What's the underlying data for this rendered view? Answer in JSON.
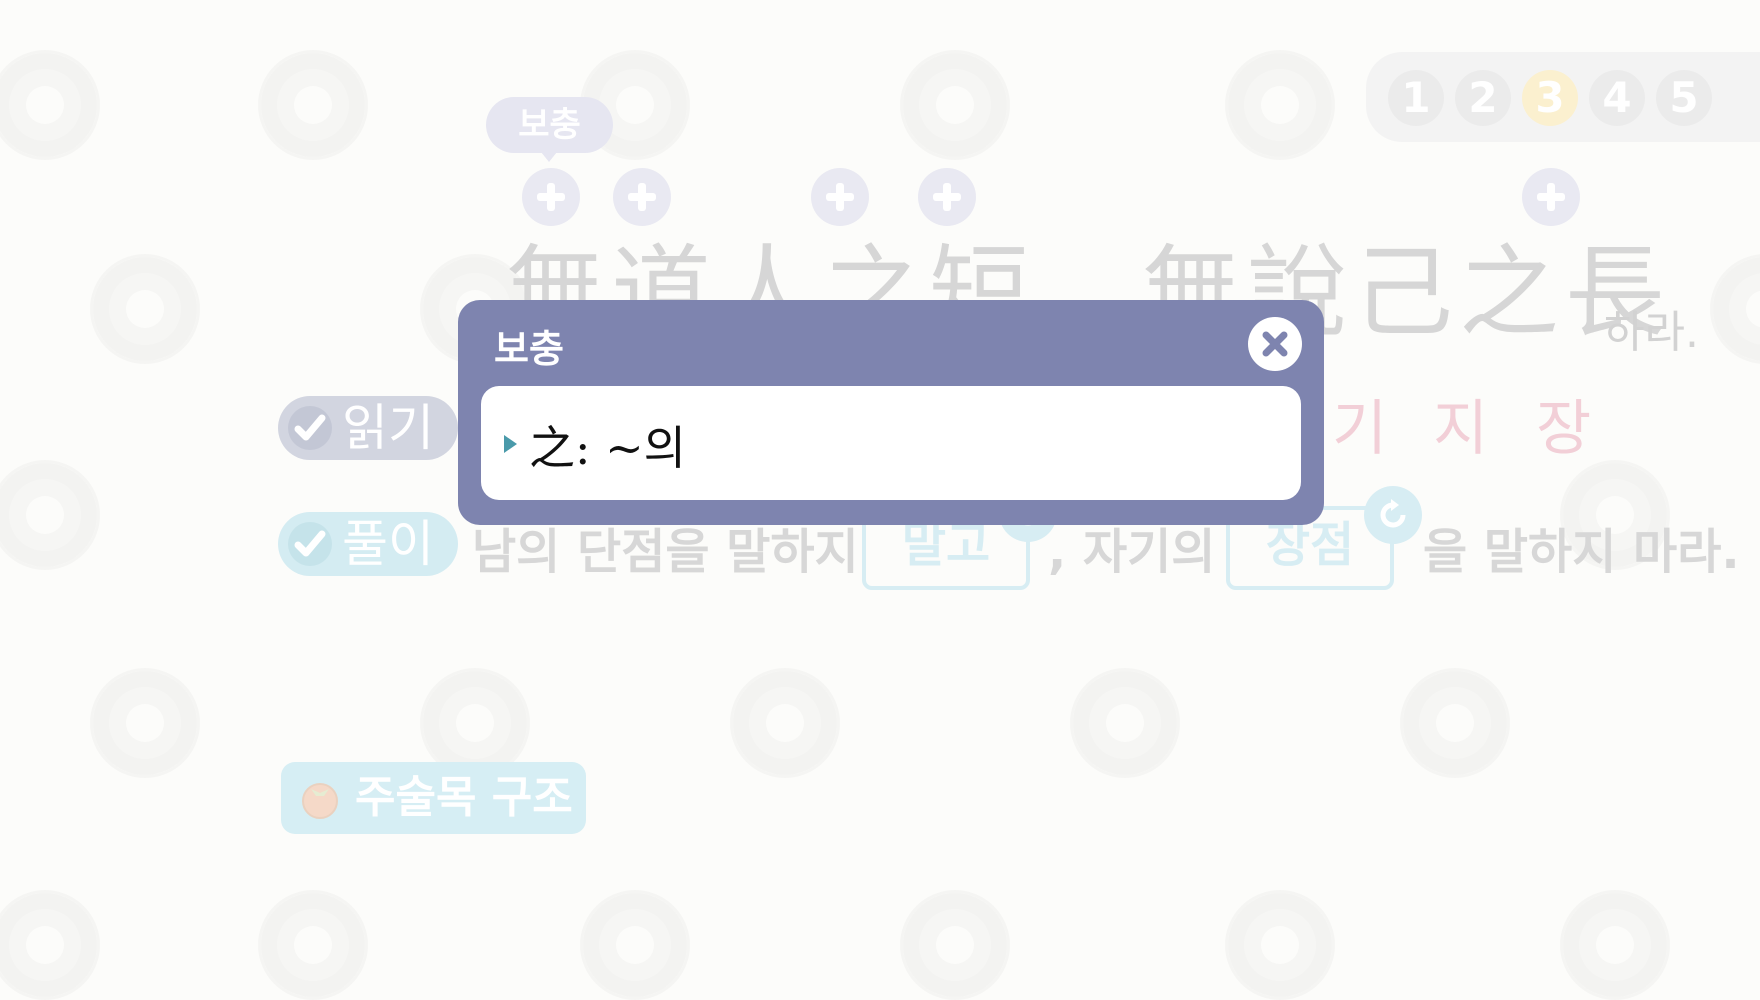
{
  "pagination": {
    "pages": [
      "1",
      "2",
      "3",
      "4",
      "5"
    ],
    "active": "3"
  },
  "tooltip": {
    "label": "보충"
  },
  "hanja_line": {
    "text": "無道人之短，無說己之長",
    "suffix": "하라."
  },
  "reading": {
    "chars": [
      "기",
      "지",
      "장"
    ]
  },
  "side_labels": {
    "reading": "읽기",
    "interpretation": "풀이"
  },
  "sentence": {
    "part1": "남의 단점을 말하지",
    "blank1": "말고",
    "part2": ", 자기의",
    "blank2": "장점",
    "part3": "을 말하지 마라."
  },
  "structure_button": {
    "label": "주술목 구조"
  },
  "dialog": {
    "title": "보충",
    "content": "之: ~의"
  },
  "colors": {
    "dialog_header": "#7e84af",
    "active_page": "#fbf0cf",
    "answer_box": "#d7edf3",
    "reading_chars": "#f2cfd7"
  }
}
